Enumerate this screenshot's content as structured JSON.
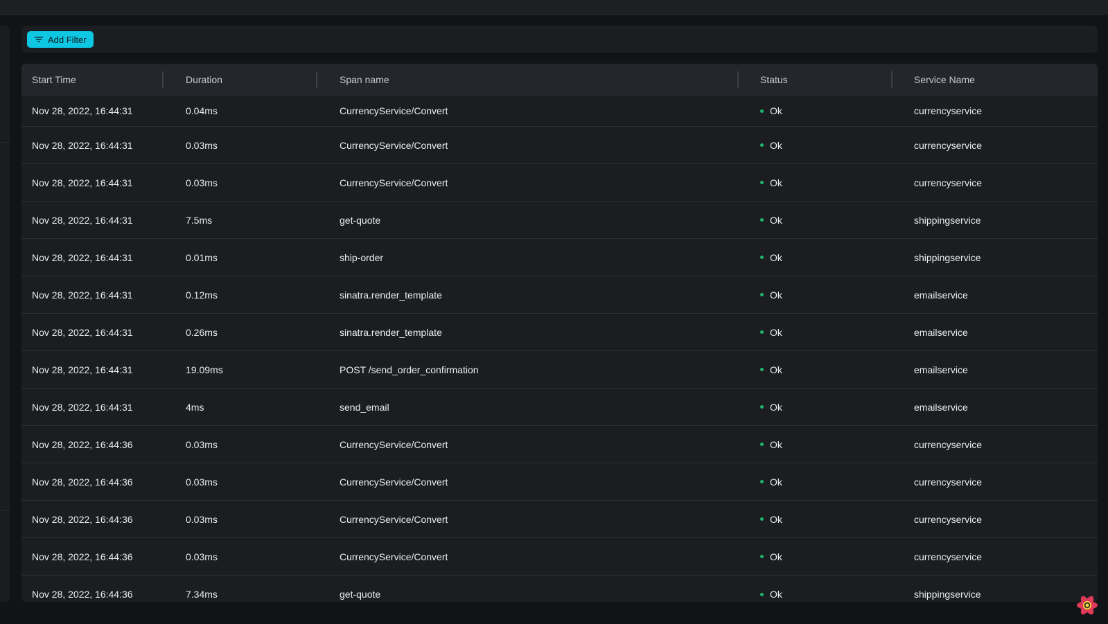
{
  "toolbar": {
    "add_filter_label": "Add Filter"
  },
  "table": {
    "columns": [
      "Start Time",
      "Duration",
      "Span name",
      "Status",
      "Service Name"
    ],
    "rows": [
      {
        "start": "Nov 28, 2022, 16:44:31",
        "duration": "0.04ms",
        "span": "CurrencyService/Convert",
        "status": "Ok",
        "service": "currencyservice"
      },
      {
        "start": "Nov 28, 2022, 16:44:31",
        "duration": "0.03ms",
        "span": "CurrencyService/Convert",
        "status": "Ok",
        "service": "currencyservice"
      },
      {
        "start": "Nov 28, 2022, 16:44:31",
        "duration": "0.03ms",
        "span": "CurrencyService/Convert",
        "status": "Ok",
        "service": "currencyservice"
      },
      {
        "start": "Nov 28, 2022, 16:44:31",
        "duration": "7.5ms",
        "span": "get-quote",
        "status": "Ok",
        "service": "shippingservice"
      },
      {
        "start": "Nov 28, 2022, 16:44:31",
        "duration": "0.01ms",
        "span": "ship-order",
        "status": "Ok",
        "service": "shippingservice"
      },
      {
        "start": "Nov 28, 2022, 16:44:31",
        "duration": "0.12ms",
        "span": "sinatra.render_template",
        "status": "Ok",
        "service": "emailservice"
      },
      {
        "start": "Nov 28, 2022, 16:44:31",
        "duration": "0.26ms",
        "span": "sinatra.render_template",
        "status": "Ok",
        "service": "emailservice"
      },
      {
        "start": "Nov 28, 2022, 16:44:31",
        "duration": "19.09ms",
        "span": "POST /send_order_confirmation",
        "status": "Ok",
        "service": "emailservice"
      },
      {
        "start": "Nov 28, 2022, 16:44:31",
        "duration": "4ms",
        "span": "send_email",
        "status": "Ok",
        "service": "emailservice"
      },
      {
        "start": "Nov 28, 2022, 16:44:36",
        "duration": "0.03ms",
        "span": "CurrencyService/Convert",
        "status": "Ok",
        "service": "currencyservice"
      },
      {
        "start": "Nov 28, 2022, 16:44:36",
        "duration": "0.03ms",
        "span": "CurrencyService/Convert",
        "status": "Ok",
        "service": "currencyservice"
      },
      {
        "start": "Nov 28, 2022, 16:44:36",
        "duration": "0.03ms",
        "span": "CurrencyService/Convert",
        "status": "Ok",
        "service": "currencyservice"
      },
      {
        "start": "Nov 28, 2022, 16:44:36",
        "duration": "0.03ms",
        "span": "CurrencyService/Convert",
        "status": "Ok",
        "service": "currencyservice"
      },
      {
        "start": "Nov 28, 2022, 16:44:36",
        "duration": "7.34ms",
        "span": "get-quote",
        "status": "Ok",
        "service": "shippingservice"
      }
    ]
  },
  "colors": {
    "accent": "#0dc7e3",
    "status_ok": "#1fb46f",
    "background": "#121316",
    "table_header": "#25262b"
  },
  "icons": {
    "filter": "filter-icon",
    "devtools": "react-devtools-icon"
  }
}
